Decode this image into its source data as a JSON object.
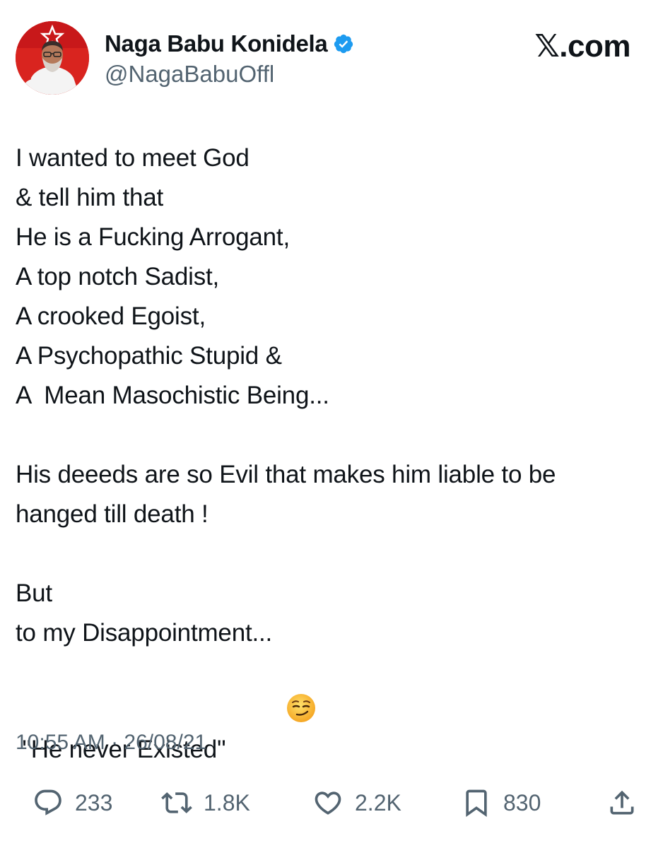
{
  "brand": {
    "label": "𝕏.com"
  },
  "author": {
    "display_name": "Naga Babu Konidela",
    "handle": "@NagaBabuOffl",
    "verified_color": "#1d9bf0"
  },
  "tweet": {
    "lines": [
      "I wanted to meet God",
      "& tell him that",
      "He is a Fucking Arrogant,",
      "A top notch Sadist,",
      "A crooked Egoist,",
      "A Psychopathic Stupid &",
      "A  Mean Masochistic Being...",
      "",
      "His deeeds are so Evil that makes him liable to be",
      "hanged till death !",
      "",
      "But",
      "to my Disappointment...",
      " \"He never Existed\""
    ],
    "emoji": "smirking-face",
    "timestamp": "10:55 AM · 26/08/21"
  },
  "actions": {
    "reply": {
      "count": "233",
      "icon": "reply-icon"
    },
    "repost": {
      "count": "1.8K",
      "icon": "repost-icon"
    },
    "like": {
      "count": "2.2K",
      "icon": "heart-icon"
    },
    "bookmark": {
      "count": "830",
      "icon": "bookmark-icon"
    },
    "share": {
      "icon": "share-icon"
    }
  },
  "colors": {
    "text": "#0f1419",
    "secondary": "#536471",
    "accent": "#1d9bf0",
    "avatar_bg": "#d9241f"
  }
}
